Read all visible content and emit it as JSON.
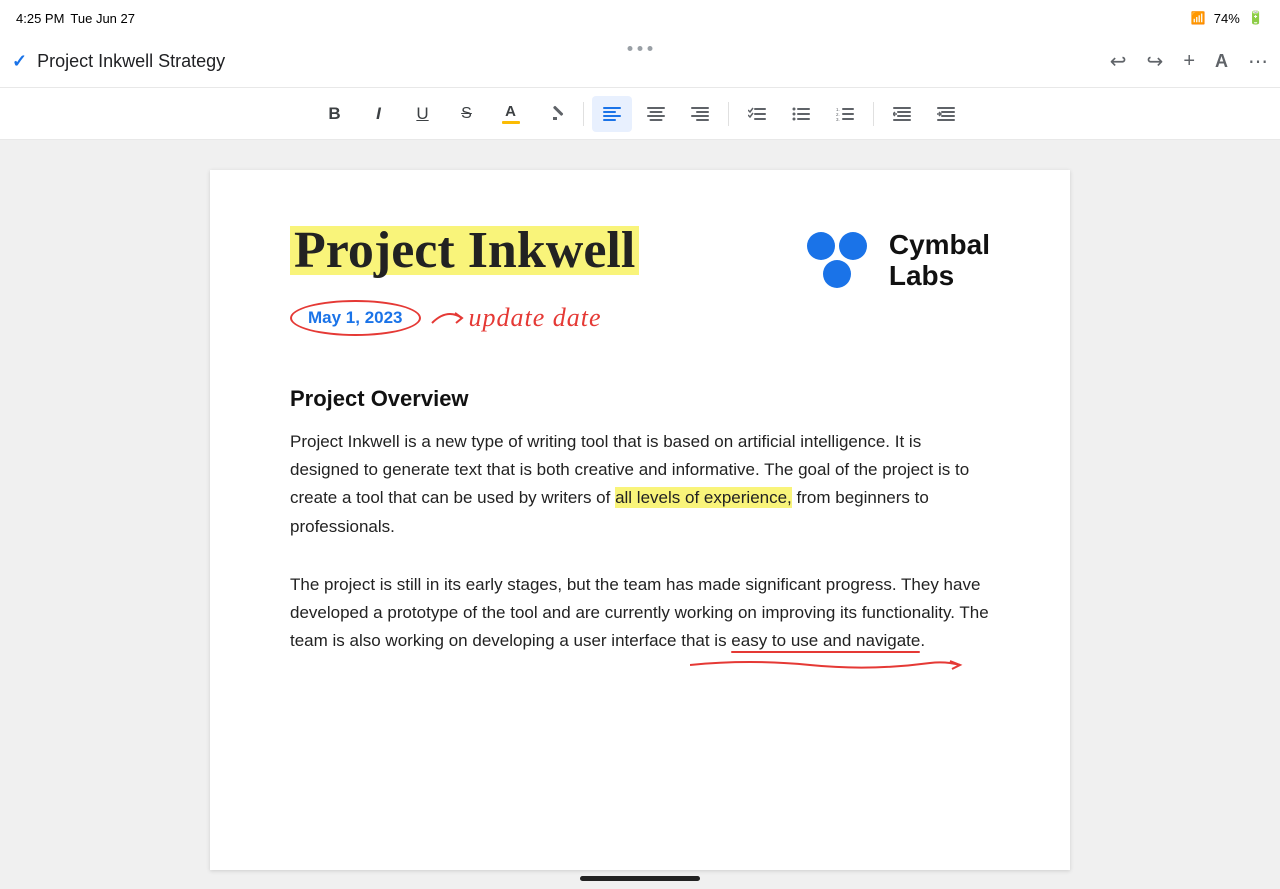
{
  "status_bar": {
    "time": "4:25 PM",
    "date": "Tue Jun 27",
    "battery": "74%"
  },
  "top_bar": {
    "title": "Project Inkwell Strategy",
    "undo_label": "undo",
    "redo_label": "redo",
    "add_label": "add",
    "font_label": "A",
    "more_label": "more"
  },
  "toolbar": {
    "bold": "B",
    "italic": "I",
    "underline": "U",
    "strikethrough": "S",
    "font_color": "A",
    "highlight": "✏",
    "align_left": "≡",
    "align_center": "≡",
    "align_right": "≡",
    "checklist": "☑",
    "bullet": "•",
    "numbered": "#",
    "indent_left": "⇤",
    "indent_right": "⇥"
  },
  "document": {
    "main_title": "Project Inkwell",
    "date": "May 1, 2023",
    "annotation": "update date",
    "cymbal_name": "Cymbal",
    "cymbal_sub": "Labs",
    "section1_heading": "Project Overview",
    "section1_para1": "Project Inkwell is a new type of writing tool that is based on artificial intelligence. It is designed to generate text that is both creative and informative. The goal of the project is to create a tool that can be used by writers of all levels of experience, from beginners to professionals.",
    "section1_highlighted": "all levels of experience,",
    "section1_para2": "The project is still in its early stages, but the team has made significant progress. They have developed a prototype of the tool and are currently working on improving its functionality. The team is also working on developing a user interface that is easy to use and navigate."
  }
}
